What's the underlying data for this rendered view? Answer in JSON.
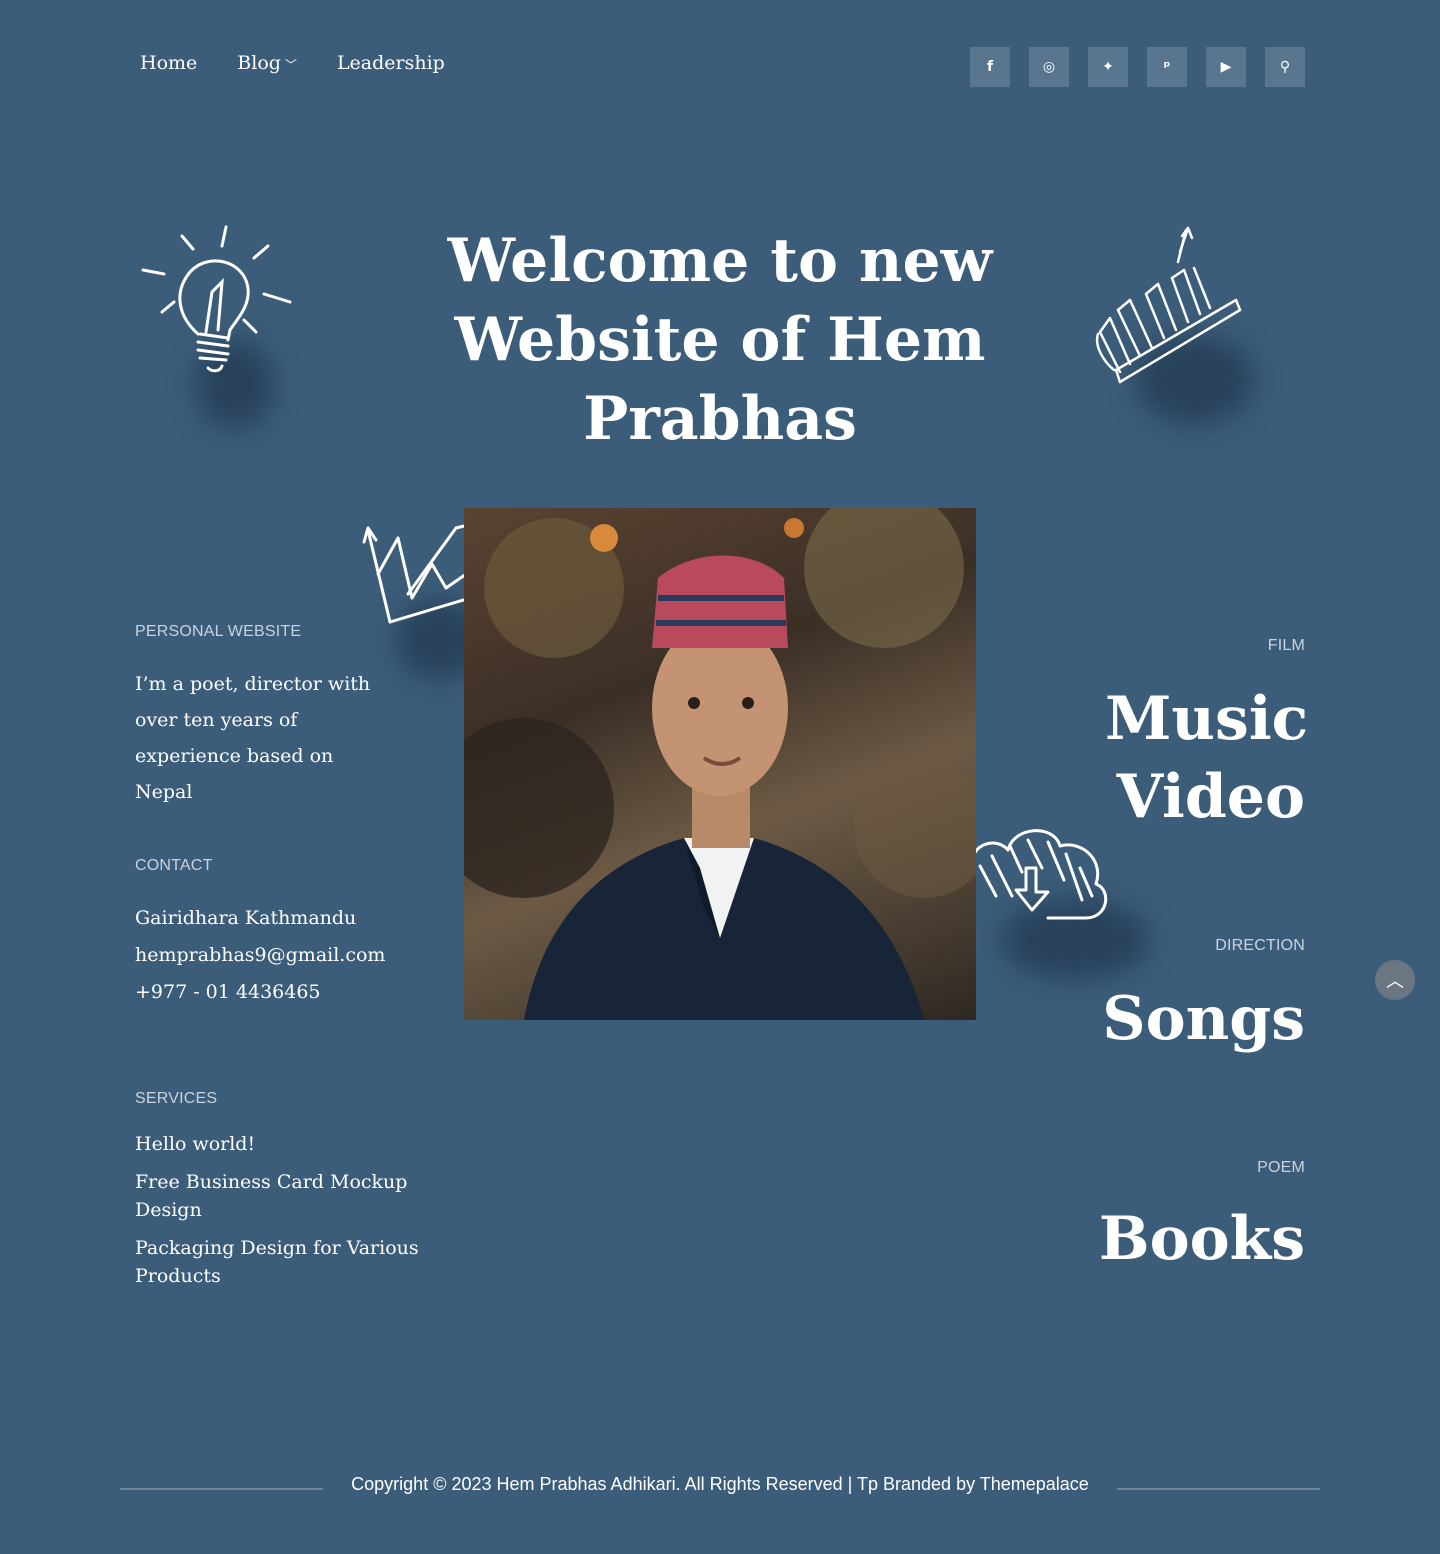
{
  "nav": {
    "items": [
      {
        "label": "Home"
      },
      {
        "label": "Blog"
      },
      {
        "label": "Leadership"
      }
    ]
  },
  "social": {
    "facebook": "f",
    "instagram": "◎",
    "twitter": "✦",
    "pinterest": "ᵖ",
    "youtube": "▶",
    "search": "⚲"
  },
  "hero": {
    "title": "Welcome to new Website of Hem Prabhas"
  },
  "left": {
    "personal_label": "PERSONAL WEBSITE",
    "bio": "I’m a poet, director with over ten years of experience based on Nepal",
    "contact_label": "CONTACT",
    "address": "Gairidhara Kathmandu",
    "email": "hemprabhas9@gmail.com",
    "phone": "+977 - 01 4436465",
    "services_label": "SERVICES",
    "services": [
      "Hello world!",
      "Free Business Card Mockup Design",
      "Packaging Design for Various Products"
    ]
  },
  "right": {
    "film_label": "FILM",
    "film_title": "Music Video",
    "direction_label": "DIRECTION",
    "direction_title": "Songs",
    "poem_label": "POEM",
    "poem_title": "Books"
  },
  "footer": {
    "copyright": "Copyright © 2023 Hem Prabhas Adhikari. All Rights Reserved | Tp Branded by Themepalace"
  },
  "colors": {
    "background": "#3c5d7a",
    "social_button": "#5a768f",
    "label_text": "#c8d4df"
  }
}
